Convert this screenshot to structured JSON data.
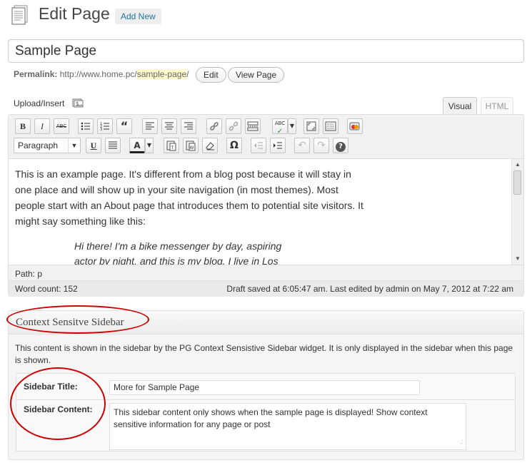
{
  "header": {
    "title": "Edit Page",
    "add_new": "Add New"
  },
  "post": {
    "title_value": "Sample Page",
    "permalink_label": "Permalink:",
    "permalink_base": "http://www.home.pc/",
    "permalink_slug": "sample-page",
    "permalink_trail": "/",
    "edit_button": "Edit",
    "view_button": "View Page"
  },
  "media": {
    "upload_insert": "Upload/Insert"
  },
  "editor_tabs": {
    "visual": "Visual",
    "html": "HTML"
  },
  "toolbar": {
    "bold": "B",
    "italic": "I",
    "strike": "ABC",
    "blockquote": "“",
    "format_select": "Paragraph",
    "underline": "U",
    "text_color": "A",
    "omega": "Ω",
    "help": "?",
    "spellcheck": "ABC"
  },
  "content": {
    "paragraph": "This is an example page. It's different from a blog post because it will stay in one place and will show up in your site navigation (in most themes). Most people start with an About page that introduces them to potential site visitors. It might say something like this:",
    "quote": "Hi there! I'm a bike messenger by day, aspiring actor by night, and this is my blog. I live in Los"
  },
  "status": {
    "path": "Path: p",
    "word_count": "Word count: 152",
    "draft_saved": "Draft saved at 6:05:47 am. Last edited by admin on May 7, 2012 at 7:22 am"
  },
  "metabox": {
    "title": "Context Sensitve Sidebar",
    "description": "This content is shown in the sidebar by the PG Context Sensistive Sidebar widget. It is only displayed in the sidebar when this page is shown.",
    "sidebar_title_label": "Sidebar Title:",
    "sidebar_title_value": "More for Sample Page",
    "sidebar_content_label": "Sidebar Content:",
    "sidebar_content_value": "This sidebar content only shows when the sample page is displayed! Show context sensitive information for any page or post"
  },
  "colors": {
    "link": "#21759b",
    "annotation_red": "#cc0000",
    "slug_highlight": "#fffbcc"
  }
}
